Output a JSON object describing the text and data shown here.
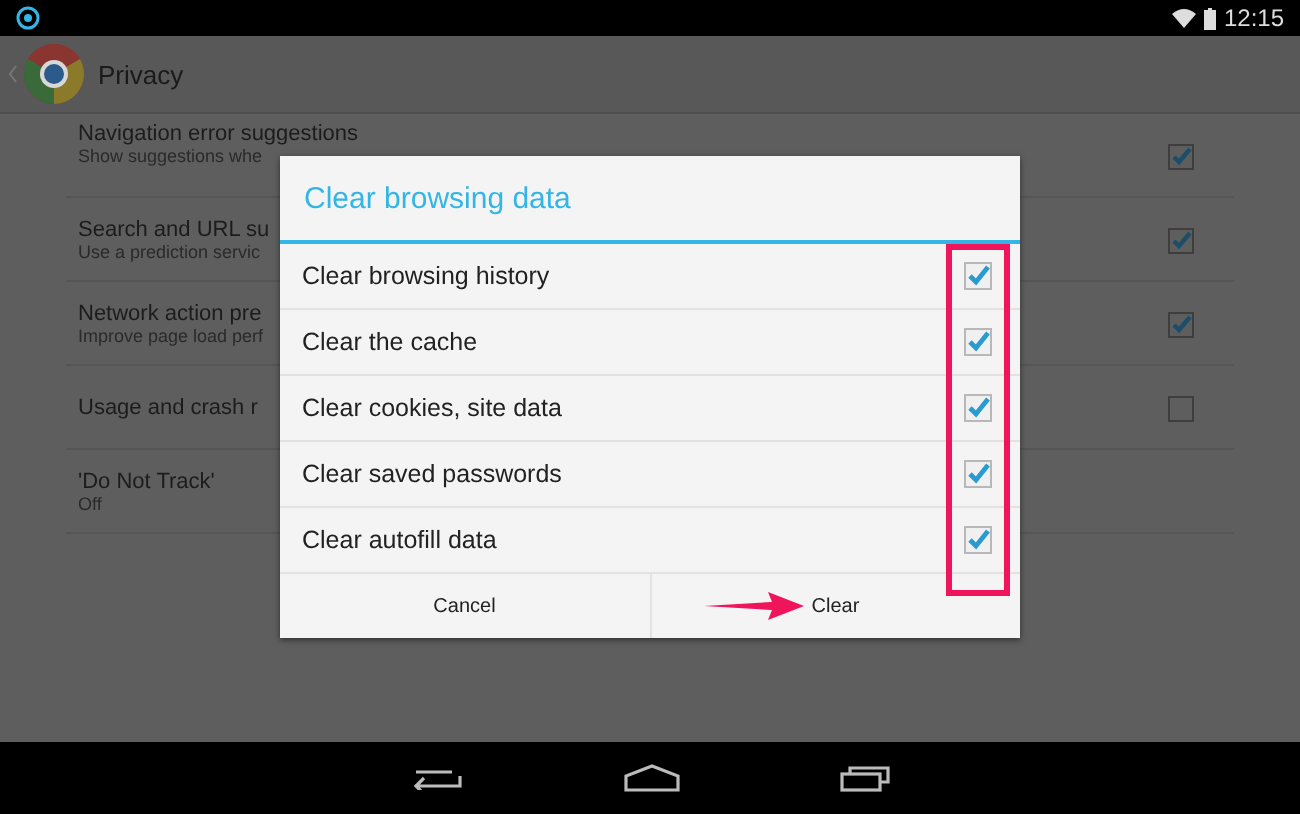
{
  "status_bar": {
    "time": "12:15"
  },
  "action_bar": {
    "title": "Privacy"
  },
  "settings": [
    {
      "title": "Navigation error suggestions",
      "summary": "Show suggestions whe",
      "checked": true
    },
    {
      "title": "Search and URL su",
      "summary": "Use a prediction servic",
      "checked": true
    },
    {
      "title": "Network action pre",
      "summary": "Improve page load perf",
      "checked": true
    },
    {
      "title": "Usage and crash r",
      "checked": false
    },
    {
      "title": "'Do Not Track'",
      "summary": "Off"
    }
  ],
  "dialog": {
    "title": "Clear browsing data",
    "items": [
      {
        "label": "Clear browsing history",
        "checked": true
      },
      {
        "label": "Clear the cache",
        "checked": true
      },
      {
        "label": "Clear cookies, site data",
        "checked": true
      },
      {
        "label": "Clear saved passwords",
        "checked": true
      },
      {
        "label": "Clear autofill data",
        "checked": true
      }
    ],
    "buttons": [
      "Cancel",
      "Clear"
    ]
  }
}
